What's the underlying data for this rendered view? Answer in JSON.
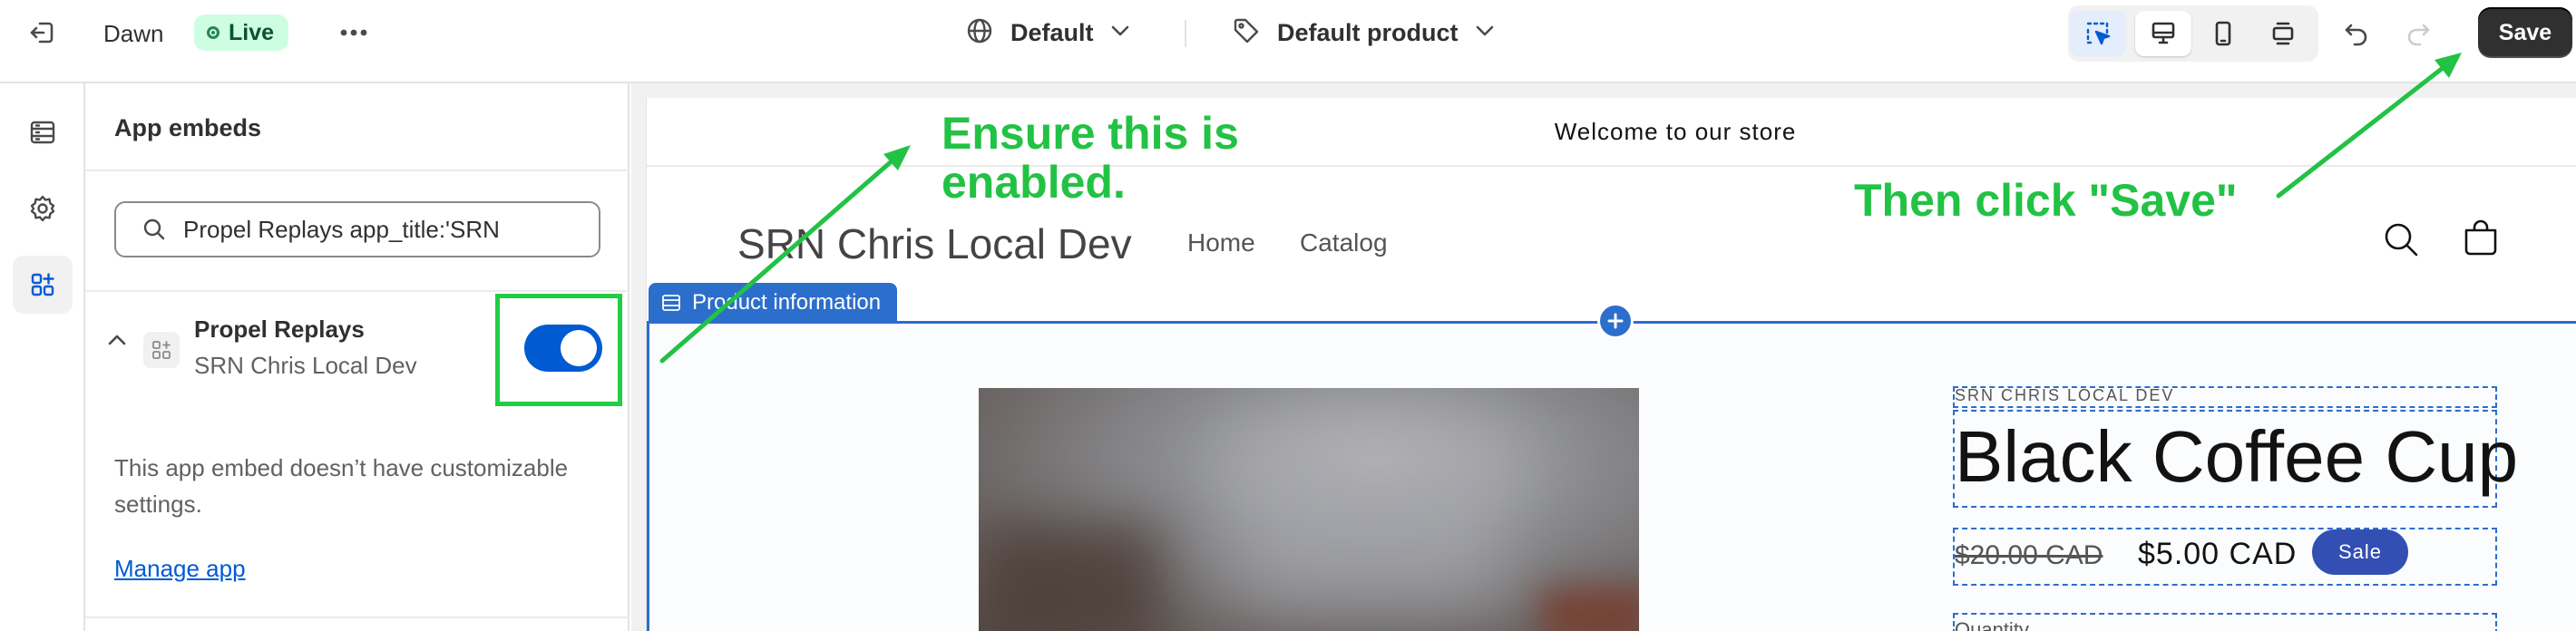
{
  "topbar": {
    "theme_name": "Dawn",
    "status_badge": "Live",
    "template_select": "Default",
    "product_select": "Default product",
    "save_label": "Save",
    "icons": [
      "exit-icon",
      "more-horizontal-icon",
      "globe-icon",
      "chevron-down-icon",
      "tag-icon",
      "inspector-icon",
      "desktop-icon",
      "mobile-icon",
      "fullscreen-icon",
      "undo-icon",
      "redo-icon"
    ]
  },
  "rail": {
    "items": [
      {
        "icon": "sections-icon",
        "selected": false
      },
      {
        "icon": "settings-icon",
        "selected": false
      },
      {
        "icon": "app-embeds-icon",
        "selected": true
      }
    ]
  },
  "panel": {
    "title": "App embeds",
    "search_value": "Propel Replays app_title:'SRN",
    "embed": {
      "name": "Propel Replays",
      "store": "SRN Chris Local Dev",
      "enabled": true
    },
    "note": "This app embed doesn’t have customizable settings.",
    "manage_link": "Manage app"
  },
  "preview": {
    "announcement": "Welcome to our store",
    "store_name": "SRN Chris Local Dev",
    "nav": [
      "Home",
      "Catalog"
    ],
    "section_label": "Product information",
    "vendor": "SRN CHRIS LOCAL DEV",
    "product_title": "Black Coffee Cup",
    "price_old": "$20.00 CAD",
    "price_new": "$5.00 CAD",
    "sale_badge": "Sale",
    "quantity_label": "Quantity"
  },
  "annotations": {
    "first": "Ensure this is enabled.",
    "second": "Then click \"Save\"",
    "color": "#22c244"
  },
  "colors": {
    "accent": "#005bd3",
    "section_outline": "#2c6ecb",
    "live_badge": "#cdfee1",
    "sale_badge": "#334fb4"
  }
}
